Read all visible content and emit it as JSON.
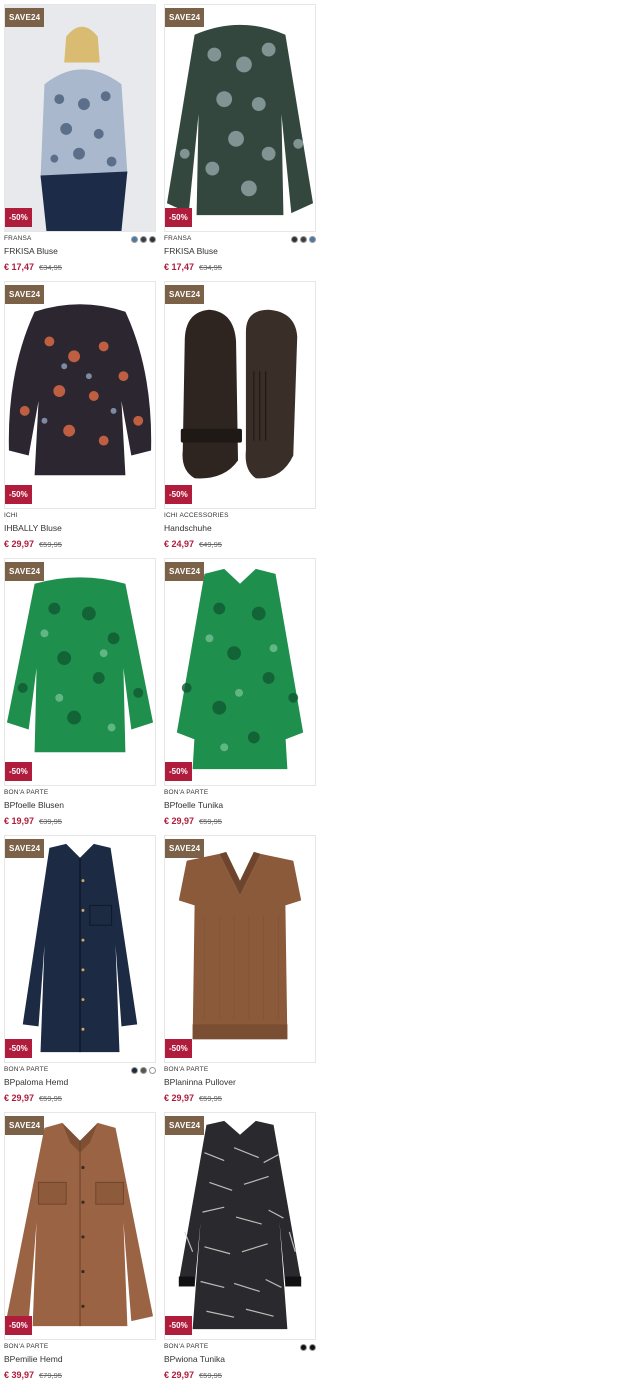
{
  "products": [
    {
      "badge": "SAVE24",
      "discount": "-50%",
      "brand": "FRANSA",
      "name": "FRKISA Bluse",
      "price": "€ 17,47",
      "old_price": "€34,95",
      "swatches": [
        "#4b7aa8",
        "#3a3f44",
        "#2f3236"
      ]
    },
    {
      "badge": "SAVE24",
      "discount": "-50%",
      "brand": "FRANSA",
      "name": "FRKISA Bluse",
      "price": "€ 17,47",
      "old_price": "€34,95",
      "swatches": [
        "#2f3236",
        "#3a3f44",
        "#4b7aa8"
      ]
    },
    {
      "badge": "SAVE24",
      "discount": "-50%",
      "brand": "ICHI",
      "name": "IHBALLY Bluse",
      "price": "€ 29,97",
      "old_price": "€59,95",
      "swatches": []
    },
    {
      "badge": "SAVE24",
      "discount": "-50%",
      "brand": "ICHI ACCESSORIES",
      "name": "Handschuhe",
      "price": "€ 24,97",
      "old_price": "€49,95",
      "swatches": []
    },
    {
      "badge": "SAVE24",
      "discount": "-50%",
      "brand": "BON'A PARTE",
      "name": "BPfoelle Blusen",
      "price": "€ 19,97",
      "old_price": "€39,95",
      "swatches": []
    },
    {
      "badge": "SAVE24",
      "discount": "-50%",
      "brand": "BON'A PARTE",
      "name": "BPfoelle Tunika",
      "price": "€ 29,97",
      "old_price": "€59,95",
      "swatches": []
    },
    {
      "badge": "SAVE24",
      "discount": "-50%",
      "brand": "BON'A PARTE",
      "name": "BPpaloma Hemd",
      "price": "€ 29,97",
      "old_price": "€59,95",
      "swatches": [
        "#1e2a40",
        "#55584a",
        "#ffffff"
      ]
    },
    {
      "badge": "SAVE24",
      "discount": "-50%",
      "brand": "BON'A PARTE",
      "name": "BPlaninna Pullover",
      "price": "€ 29,97",
      "old_price": "€59,95",
      "swatches": []
    },
    {
      "badge": "SAVE24",
      "discount": "-50%",
      "brand": "BON'A PARTE",
      "name": "BPemilie Hemd",
      "price": "€ 39,97",
      "old_price": "€79,95",
      "swatches": []
    },
    {
      "badge": "SAVE24",
      "discount": "-50%",
      "brand": "BON'A PARTE",
      "name": "BPwiona Tunika",
      "price": "€ 29,97",
      "old_price": "€59,95",
      "swatches": [
        "#111111",
        "#111111"
      ]
    }
  ]
}
